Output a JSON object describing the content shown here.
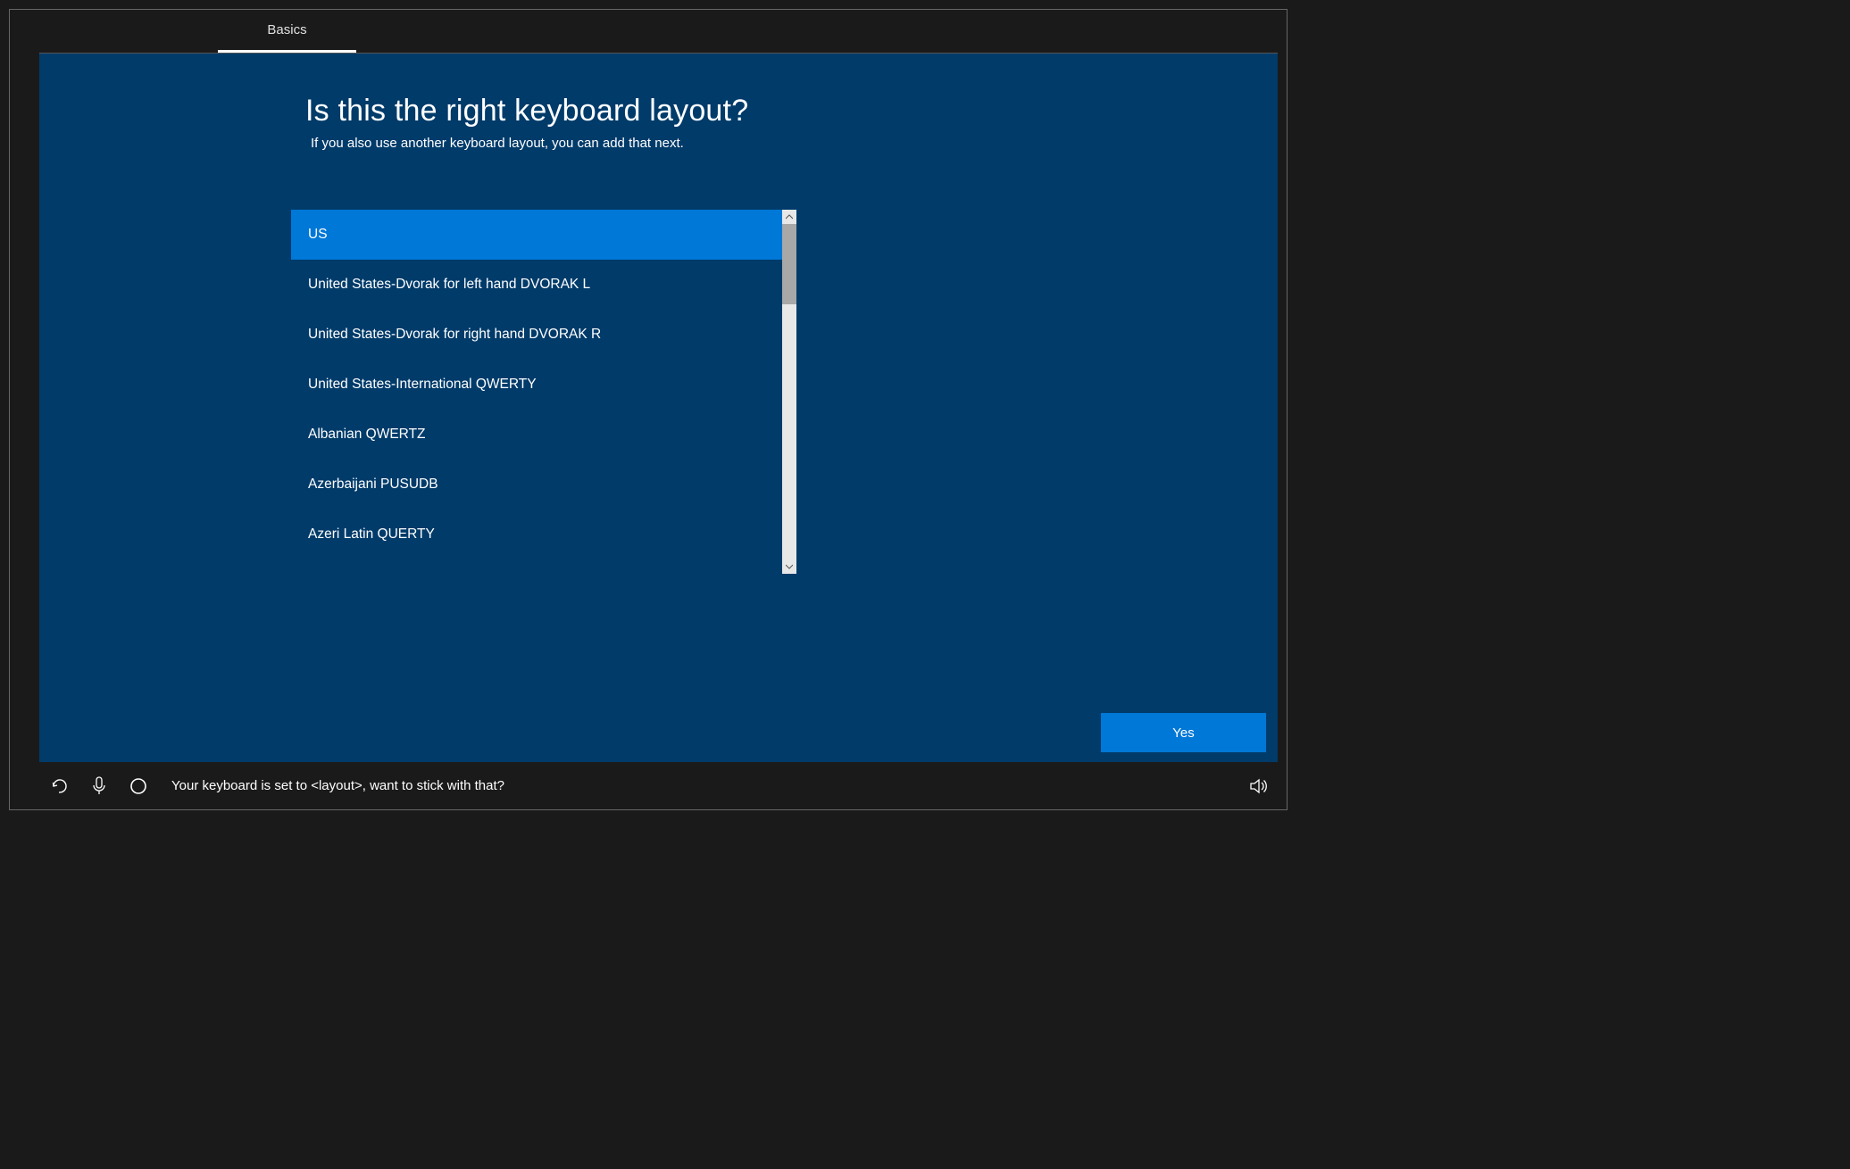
{
  "tab": {
    "label": "Basics"
  },
  "heading": "Is this the right keyboard layout?",
  "subheading": "If you also use another keyboard layout, you can add that next.",
  "keyboard_layouts": {
    "items": [
      {
        "label": "US",
        "selected": true
      },
      {
        "label": "United States-Dvorak for left hand DVORAK L",
        "selected": false
      },
      {
        "label": "United States-Dvorak for right hand DVORAK R",
        "selected": false
      },
      {
        "label": "United States-International QWERTY",
        "selected": false
      },
      {
        "label": "Albanian QWERTZ",
        "selected": false
      },
      {
        "label": "Azerbaijani PUSUDB",
        "selected": false
      },
      {
        "label": "Azeri Latin QUERTY",
        "selected": false
      }
    ]
  },
  "buttons": {
    "yes": "Yes"
  },
  "bottom_bar": {
    "message": "Your keyboard is set to <layout>, want to stick with that?"
  }
}
